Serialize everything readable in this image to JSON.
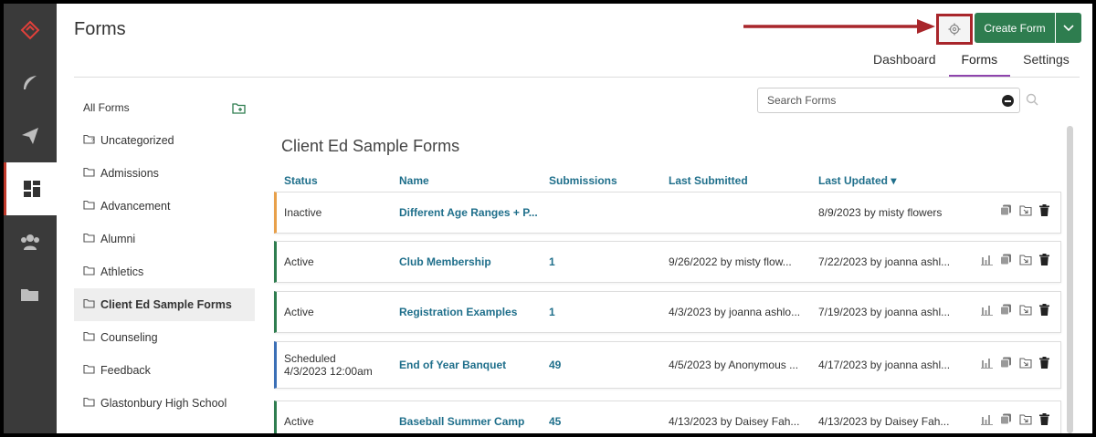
{
  "header": {
    "title": "Forms",
    "create_label": "Create Form",
    "tabs": [
      {
        "label": "Dashboard"
      },
      {
        "label": "Forms"
      },
      {
        "label": "Settings"
      }
    ]
  },
  "colors": {
    "accent_green": "#2e7d4f",
    "highlight_red": "#a8262b",
    "link_teal": "#1f6f8b",
    "inactive_orange": "#e8a04a",
    "scheduled_blue": "#3b6fb6"
  },
  "sidebar": {
    "head_label": "All Forms",
    "items": [
      {
        "label": "Uncategorized"
      },
      {
        "label": "Admissions"
      },
      {
        "label": "Advancement"
      },
      {
        "label": "Alumni"
      },
      {
        "label": "Athletics"
      },
      {
        "label": "Client Ed Sample Forms"
      },
      {
        "label": "Counseling"
      },
      {
        "label": "Feedback"
      },
      {
        "label": "Glastonbury High School"
      }
    ]
  },
  "search": {
    "placeholder": "Search Forms"
  },
  "main": {
    "section_title": "Client Ed Sample Forms",
    "columns": {
      "status": "Status",
      "name": "Name",
      "submissions": "Submissions",
      "last_submitted": "Last Submitted",
      "last_updated": "Last Updated ▾"
    },
    "rows": [
      {
        "status": "Inactive",
        "status_sub": "",
        "name": "Different Age Ranges + P...",
        "submissions": "",
        "last_submitted": "",
        "last_updated": "8/9/2023 by misty flowers"
      },
      {
        "status": "Active",
        "status_sub": "",
        "name": "Club Membership",
        "submissions": "1",
        "last_submitted": "9/26/2022 by misty flow...",
        "last_updated": "7/22/2023 by joanna ashl..."
      },
      {
        "status": "Active",
        "status_sub": "",
        "name": "Registration Examples",
        "submissions": "1",
        "last_submitted": "4/3/2023 by joanna ashlo...",
        "last_updated": "7/19/2023 by joanna ashl..."
      },
      {
        "status": "Scheduled",
        "status_sub": "4/3/2023 12:00am",
        "name": "End of Year Banquet",
        "submissions": "49",
        "last_submitted": "4/5/2023 by Anonymous ...",
        "last_updated": "4/17/2023 by joanna ashl..."
      },
      {
        "status": "Active",
        "status_sub": "",
        "name": "Baseball Summer Camp",
        "submissions": "45",
        "last_submitted": "4/13/2023 by Daisey Fah...",
        "last_updated": "4/13/2023 by Daisey Fah..."
      }
    ]
  }
}
